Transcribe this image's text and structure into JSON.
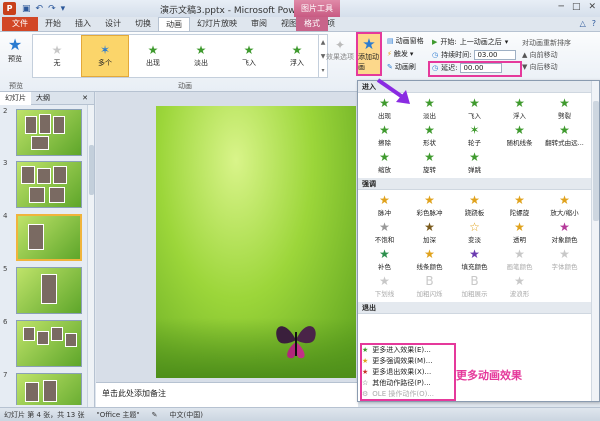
{
  "window": {
    "title": "演示文稿3.pptx - Microsoft PowerPoint",
    "app_icon": "P",
    "context_tool": "图片工具"
  },
  "tabs": [
    "文件",
    "开始",
    "插入",
    "设计",
    "切换",
    "动画",
    "幻灯片放映",
    "审阅",
    "视图",
    "加载项"
  ],
  "format_tab": "格式",
  "ribbon": {
    "preview_label": "预览",
    "preview_group": "预览",
    "animations": [
      {
        "label": "无",
        "icon": "star-gray-icon"
      },
      {
        "label": "多个",
        "icon": "star-multi-icon"
      },
      {
        "label": "出现",
        "icon": "star-green-icon"
      },
      {
        "label": "淡出",
        "icon": "star-green-icon"
      },
      {
        "label": "飞入",
        "icon": "star-green-icon"
      },
      {
        "label": "浮入",
        "icon": "star-green-icon"
      }
    ],
    "effect_options": "效果选项",
    "animation_group": "动画",
    "add_animation": "添加动画",
    "animation_pane": "动画窗格",
    "trigger": "触发",
    "animation_painter": "动画刷",
    "start_label": "开始:",
    "start_value": "上一动画之后",
    "duration_label": "持续时间:",
    "duration_value": "03.00",
    "delay_label": "延迟:",
    "delay_value": "00.00",
    "reorder_title": "对动画重新排序",
    "move_earlier": "向前移动",
    "move_later": "向后移动"
  },
  "left_pane": {
    "tab_slides": "幻灯片",
    "tab_outline": "大纲",
    "slide_numbers": [
      "2",
      "3",
      "4",
      "5",
      "6",
      "7"
    ]
  },
  "notes_placeholder": "单击此处添加备注",
  "dropdown": {
    "entrance_header": "进入",
    "entrance": [
      "出现",
      "淡出",
      "飞入",
      "浮入",
      "劈裂",
      "擦除",
      "形状",
      "轮子",
      "随机线条",
      "翻转式由远...",
      "缩放",
      "旋转",
      "弹跳"
    ],
    "emphasis_header": "强调",
    "emphasis": [
      "脉冲",
      "彩色脉冲",
      "跷跷板",
      "陀螺旋",
      "放大/缩小",
      "不饱和",
      "加深",
      "变淡",
      "透明",
      "对象颜色",
      "补色",
      "线条颜色",
      "填充颜色",
      "画笔颜色",
      "字体颜色",
      "下划线",
      "加粗闪烁",
      "加粗展示",
      "波浪形"
    ],
    "exit_header": "退出",
    "more": [
      {
        "label": "更多进入效果(E)...",
        "icon": "star-green-icon"
      },
      {
        "label": "更多强调效果(M)...",
        "icon": "star-yellow-icon"
      },
      {
        "label": "更多退出效果(X)...",
        "icon": "star-red-icon"
      },
      {
        "label": "其他动作路径(P)...",
        "icon": "star-outline-icon"
      }
    ],
    "ole": "OLE 操作动作(O)..."
  },
  "annotation": "更多动画效果",
  "status": {
    "slide_info": "幻灯片 第 4 张，共 13 张",
    "theme": "\"Office 主题\"",
    "language": "中文(中国)"
  }
}
